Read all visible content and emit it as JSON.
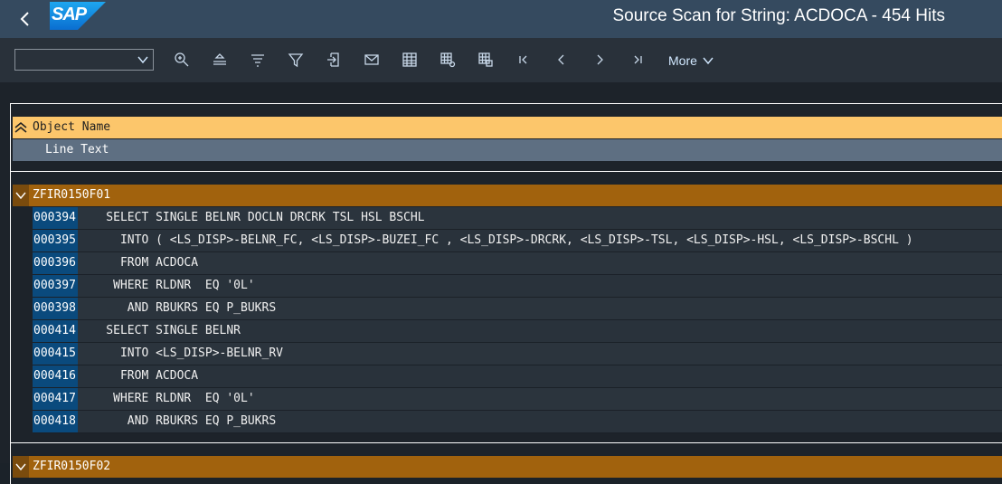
{
  "header": {
    "logo": "SAP",
    "title": "Source Scan for String: ACDOCA - 454 Hits"
  },
  "toolbar": {
    "select_value": "",
    "more_label": "More",
    "icons": [
      "search-icon",
      "align-top-icon",
      "align-middle-icon",
      "filter-icon",
      "export-icon",
      "email-icon",
      "grid-icon",
      "grid-settings-icon",
      "grid-layout-icon",
      "first-page-icon",
      "previous-page-icon",
      "next-page-icon",
      "last-page-icon"
    ]
  },
  "list": {
    "header_object": "Object Name",
    "header_line": "Line Text",
    "groups": [
      {
        "name": "ZFIR0150F01",
        "rows": [
          {
            "num": "000394",
            "text": "    SELECT SINGLE BELNR DOCLN DRCRK TSL HSL BSCHL"
          },
          {
            "num": "000395",
            "text": "      INTO ( <LS_DISP>-BELNR_FC, <LS_DISP>-BUZEI_FC , <LS_DISP>-DRCRK, <LS_DISP>-TSL, <LS_DISP>-HSL, <LS_DISP>-BSCHL )"
          },
          {
            "num": "000396",
            "text": "      FROM ACDOCA"
          },
          {
            "num": "000397",
            "text": "     WHERE RLDNR  EQ '0L'"
          },
          {
            "num": "000398",
            "text": "       AND RBUKRS EQ P_BUKRS"
          },
          {
            "num": "000414",
            "text": "    SELECT SINGLE BELNR"
          },
          {
            "num": "000415",
            "text": "      INTO <LS_DISP>-BELNR_RV"
          },
          {
            "num": "000416",
            "text": "      FROM ACDOCA"
          },
          {
            "num": "000417",
            "text": "     WHERE RLDNR  EQ '0L'"
          },
          {
            "num": "000418",
            "text": "       AND RBUKRS EQ P_BUKRS"
          }
        ]
      },
      {
        "name": "ZFIR0150F02",
        "rows": []
      }
    ]
  }
}
